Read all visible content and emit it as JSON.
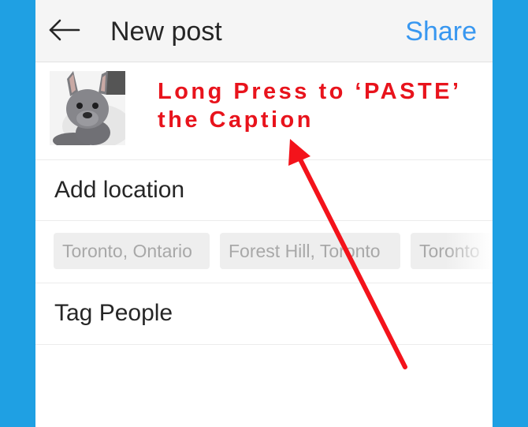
{
  "header": {
    "back_icon": "arrow-left-icon",
    "title": "New post",
    "share_label": "Share",
    "share_color": "#3897f0"
  },
  "caption": {
    "thumbnail": "french-bulldog-photo",
    "annotation_line1": "Long Press to ‘PASTE’",
    "annotation_line2": "the Caption",
    "annotation_color": "#e8131c"
  },
  "location": {
    "label": "Add location",
    "suggestions": [
      "Toronto, Ontario",
      "Forest Hill, Toronto",
      "Toronto"
    ]
  },
  "tag_people": {
    "label": "Tag People"
  },
  "colors": {
    "background": "#1fa0e3",
    "header_bg": "#f5f5f5",
    "chip_bg": "#eeeeee"
  }
}
